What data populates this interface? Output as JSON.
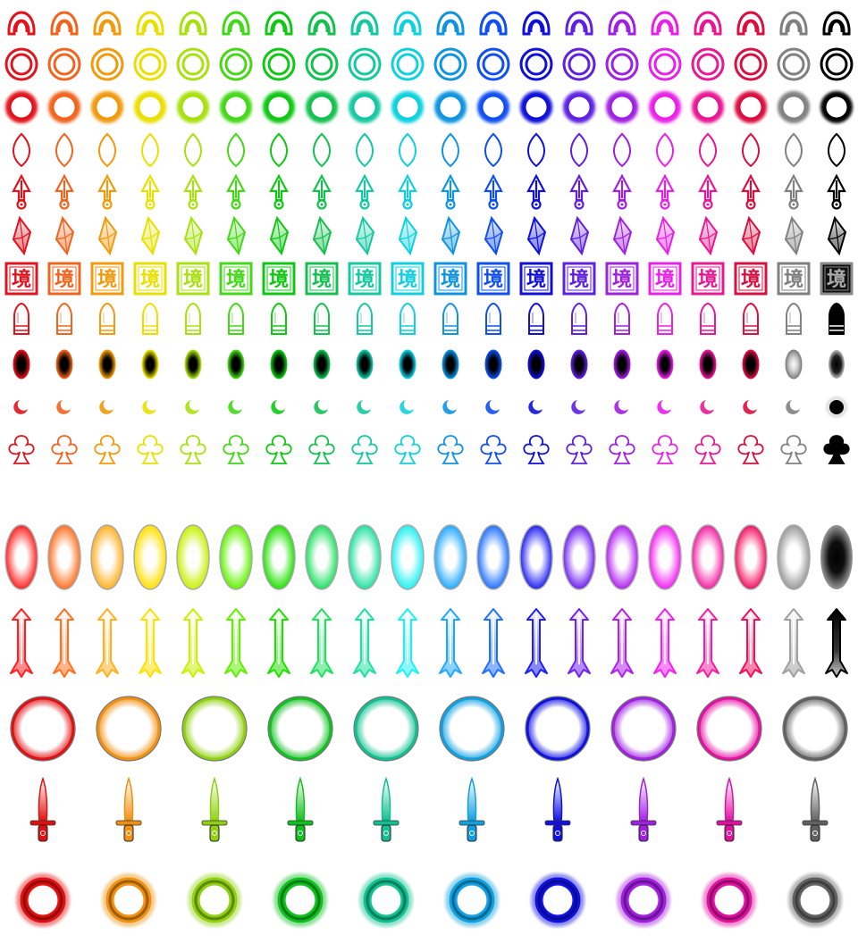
{
  "sheet": {
    "kanji_glyph": "境",
    "small_palette": [
      "#e0141c",
      "#f0641e",
      "#f09a0c",
      "#e8e000",
      "#a8e010",
      "#44d818",
      "#10c814",
      "#14c050",
      "#14c8a0",
      "#10d0e0",
      "#1094e0",
      "#1050f0",
      "#1010d8",
      "#6020e0",
      "#a020e0",
      "#e820e8",
      "#e81894",
      "#d81040",
      "#808080",
      "#000000"
    ],
    "large_palette": [
      "#ff2020",
      "#ff7020",
      "#ffb020",
      "#ffe000",
      "#c8f000",
      "#60f000",
      "#20e000",
      "#20e060",
      "#20e0a0",
      "#20f0f0",
      "#20a8ff",
      "#2070ff",
      "#2020f0",
      "#7020f0",
      "#b020f0",
      "#f020f0",
      "#f020a0",
      "#f01060",
      "#a0a0a0",
      "#000000"
    ],
    "wide_palette": [
      "#e01010",
      "#f09010",
      "#90d010",
      "#10c020",
      "#10c090",
      "#10a0e0",
      "#1010e0",
      "#a020e0",
      "#e010a0",
      "#606060"
    ],
    "small_rows": [
      {
        "shape": "double-arch"
      },
      {
        "shape": "double-ring"
      },
      {
        "shape": "glow-ring"
      },
      {
        "shape": "leaf-outline"
      },
      {
        "shape": "arrowhead-pin"
      },
      {
        "shape": "crystal"
      },
      {
        "shape": "kanji-tile"
      },
      {
        "shape": "bullet-capsule"
      },
      {
        "shape": "dark-oval"
      },
      {
        "shape": "crescent"
      },
      {
        "shape": "club-outline"
      }
    ],
    "large_rows": [
      {
        "shape": "big-glow-oval"
      },
      {
        "shape": "arrow-bullet"
      }
    ],
    "wide_rows": [
      {
        "shape": "wide-ring"
      },
      {
        "shape": "dagger"
      },
      {
        "shape": "donut"
      }
    ]
  }
}
